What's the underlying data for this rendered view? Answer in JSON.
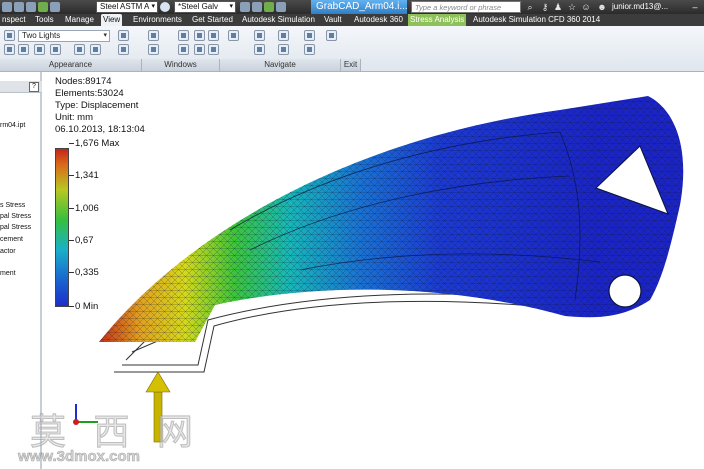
{
  "title_bar": {
    "material_1": "Steel ASTM A",
    "material_2": "*Steel Galv",
    "app_title": "GrabCAD_Arm04.i...",
    "search_placeholder": "Type a keyword or phrase",
    "user": "junior.md13@..."
  },
  "tabs": [
    {
      "label": "nspect"
    },
    {
      "label": "Tools"
    },
    {
      "label": "Manage"
    },
    {
      "label": "View"
    },
    {
      "label": "Environments"
    },
    {
      "label": "Get Started"
    },
    {
      "label": "Autodesk Simulation"
    },
    {
      "label": "Vault"
    },
    {
      "label": "Autodesk 360"
    },
    {
      "label": "Stress Analysis"
    },
    {
      "label": "Autodesk Simulation CFD 360 2014"
    }
  ],
  "ribbon": {
    "lighting_select": "Two Lights",
    "groups": {
      "appearance": "Appearance",
      "windows": "Windows",
      "navigate": "Navigate",
      "exit": "Exit"
    }
  },
  "browser": {
    "items": [
      "rm04.ipt",
      "s Stress",
      "pal Stress",
      "pal Stress",
      "cement",
      "actor",
      "ment"
    ]
  },
  "result_info": {
    "nodes": "Nodes:89174",
    "elements": "Elements:53024",
    "type": "Type: Displacement",
    "unit": "Unit: mm",
    "timestamp": "06.10.2013, 18:13:04"
  },
  "legend": {
    "labels": [
      "1,676 Max",
      "1,341",
      "1,006",
      "0,67",
      "0,335",
      "0 Min"
    ],
    "colors": [
      "#c4241a",
      "#b8c821",
      "#36c03e",
      "#1ab0c8",
      "#1a6ad0",
      "#1c2ec9"
    ]
  },
  "watermark": {
    "chars": "莫 西 网",
    "url": "www.3dmox.com"
  },
  "colors": {
    "stress_tab": "#8fc15a",
    "title_tab": "#2f7fc8",
    "load_arrow": "#c8b400"
  }
}
